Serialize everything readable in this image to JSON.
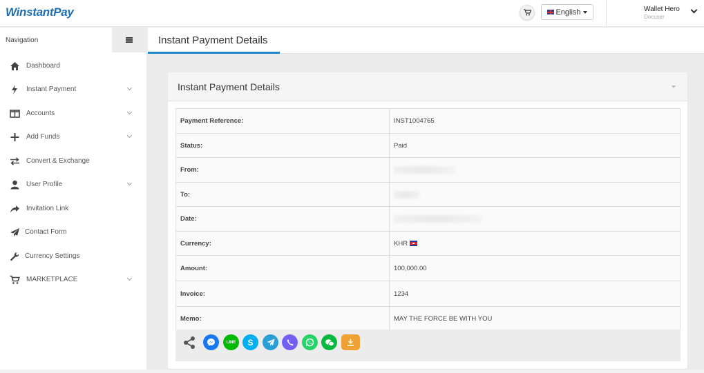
{
  "header": {
    "logo": "WinstantPay",
    "language": "English",
    "user_name": "Wallet Hero",
    "user_role": "Docuser"
  },
  "sidebar": {
    "title": "Navigation",
    "items": [
      {
        "label": "Dashboard",
        "icon": "home-icon",
        "expandable": false
      },
      {
        "label": "Instant Payment",
        "icon": "bolt-icon",
        "expandable": true
      },
      {
        "label": "Accounts",
        "icon": "columns-icon",
        "expandable": true
      },
      {
        "label": "Add Funds",
        "icon": "plus-icon",
        "expandable": true
      },
      {
        "label": "Convert & Exchange",
        "icon": "exchange-icon",
        "expandable": false
      },
      {
        "label": "User Profile",
        "icon": "user-icon",
        "expandable": true
      },
      {
        "label": "Invitation Link",
        "icon": "share-arrow-icon",
        "expandable": false
      },
      {
        "label": "Contact Form",
        "icon": "paper-plane-icon",
        "expandable": false
      },
      {
        "label": "Currency Settings",
        "icon": "wrench-icon",
        "expandable": false
      },
      {
        "label": "MARKETPLACE",
        "icon": "cart-icon",
        "expandable": true
      }
    ]
  },
  "main": {
    "page_title": "Instant Payment Details",
    "panel_title": "Instant Payment Details",
    "details": [
      {
        "key": "Payment Reference:",
        "value": "INST1004765",
        "blurred": false
      },
      {
        "key": "Status:",
        "value": "Paid",
        "blurred": false
      },
      {
        "key": "From:",
        "value": "",
        "blurred": true
      },
      {
        "key": "To:",
        "value": "",
        "blurred": true
      },
      {
        "key": "Date:",
        "value": "",
        "blurred": true
      },
      {
        "key": "Currency:",
        "value": "KHR",
        "blurred": false,
        "flag": "cambodia-flag-icon"
      },
      {
        "key": "Amount:",
        "value": "100,000.00",
        "blurred": false
      },
      {
        "key": "Invoice:",
        "value": "1234",
        "blurred": false
      },
      {
        "key": "Memo:",
        "value": "MAY THE FORCE BE WITH YOU",
        "blurred": false
      }
    ],
    "share_icons": [
      {
        "name": "share-icon",
        "color": "#555555"
      },
      {
        "name": "messenger-icon",
        "color": "#1877f2"
      },
      {
        "name": "line-icon",
        "color": "#00b900"
      },
      {
        "name": "skype-icon",
        "color": "#00aff0"
      },
      {
        "name": "telegram-icon",
        "color": "#2a9fd6"
      },
      {
        "name": "viber-icon",
        "color": "#7360f2"
      },
      {
        "name": "whatsapp-icon",
        "color": "#25d366"
      },
      {
        "name": "wechat-icon",
        "color": "#09b83e"
      },
      {
        "name": "download-icon",
        "color": "#f0a134"
      }
    ]
  },
  "colors": {
    "brand": "#1f6fb5",
    "accent_tab": "#1e88c8"
  }
}
